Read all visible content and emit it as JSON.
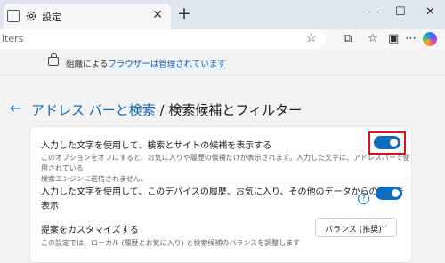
{
  "tab": {
    "title": "設定",
    "close": "✕",
    "new_tab": "+"
  },
  "window_controls": {
    "minimize": "—",
    "maximize": "☐",
    "close": "✕"
  },
  "address_bar": {
    "text": "lters",
    "favorite_icon": "☆"
  },
  "toolbar": {
    "extensions_icon": "⧉",
    "favorites_icon": "☆",
    "collections_icon": "▣",
    "more_icon": "⋯"
  },
  "banner": {
    "prefix": "組織による",
    "link": "ブラウザーは管理されています"
  },
  "header": {
    "back_icon": "←",
    "crumb": "アドレス バーと検索",
    "separator": " / ",
    "title": "検索候補とフィルター"
  },
  "settings": {
    "item1": {
      "label": "入力した文字を使用して、検索とサイトの候補を表示する",
      "desc_line1": "このオプションをオフにすると、お気に入りや履歴の候補だけが表示されます。入力した文字は、アドレスバーで使用されている",
      "desc_line2": "検索エンジンに送信されません。",
      "enabled": true
    },
    "item2": {
      "label_line1": "入力した文字を使用して、このデバイスの履歴、お気に入り、その他のデータからの候補を",
      "label_line2": "表示",
      "help_icon": "?",
      "enabled": true
    },
    "item3": {
      "label": "提案をカスタマイズする",
      "desc": "この設定では、ローカル (履歴とお気に入り) と検索候補のバランスを調整します",
      "select_value": "バランス (推奨)",
      "chevron": "⌵"
    }
  },
  "colors": {
    "accent": "#0f6cbd",
    "highlight": "#e0101a"
  }
}
